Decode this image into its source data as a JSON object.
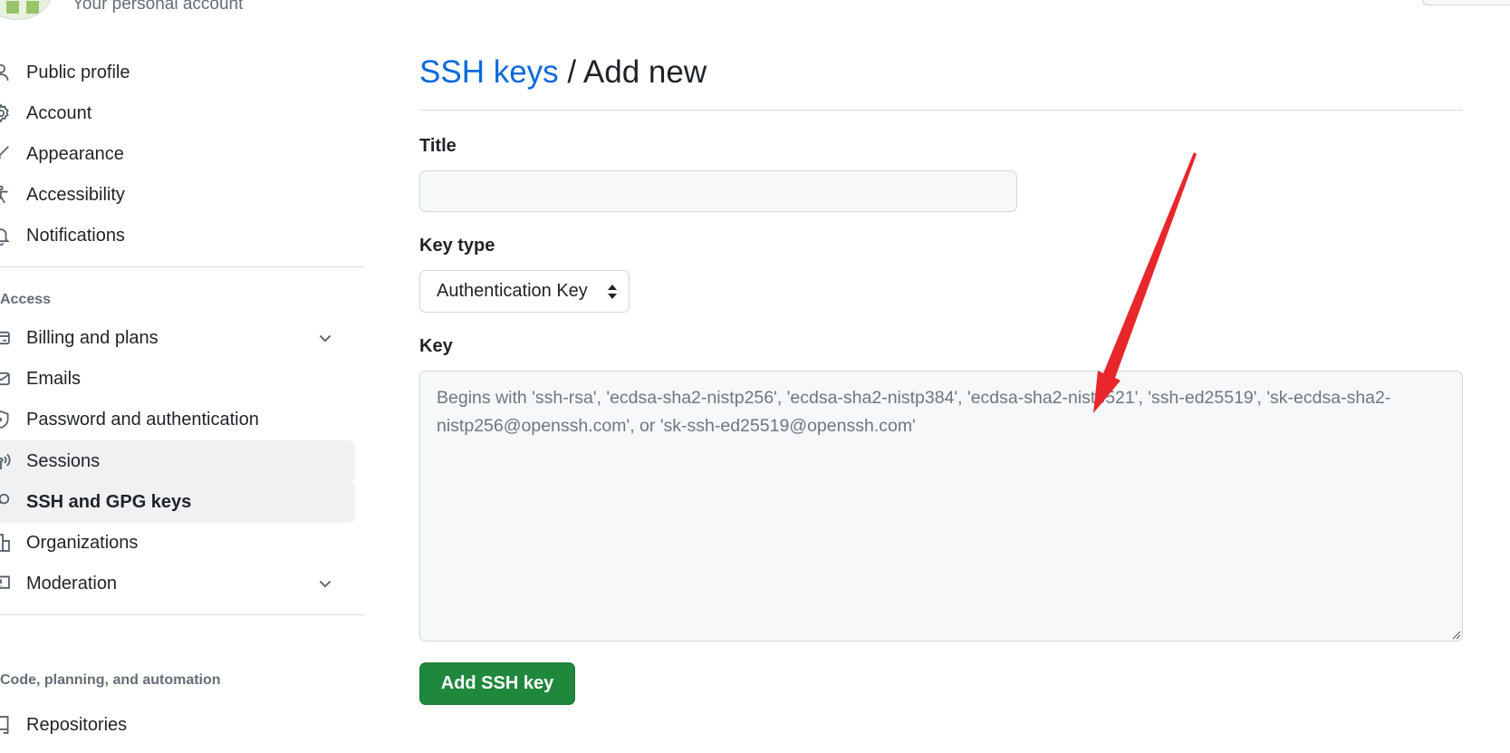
{
  "account": {
    "subtitle": "Your personal account"
  },
  "sidebar": {
    "items_top": [
      {
        "label": "Public profile",
        "icon": "person-icon"
      },
      {
        "label": "Account",
        "icon": "gear-icon"
      },
      {
        "label": "Appearance",
        "icon": "paintbrush-icon"
      },
      {
        "label": "Accessibility",
        "icon": "accessibility-icon"
      },
      {
        "label": "Notifications",
        "icon": "bell-icon"
      }
    ],
    "access_heading": "Access",
    "items_access": [
      {
        "label": "Billing and plans",
        "icon": "credit-card-icon",
        "expandable": true
      },
      {
        "label": "Emails",
        "icon": "mail-icon"
      },
      {
        "label": "Password and authentication",
        "icon": "shield-lock-icon"
      },
      {
        "label": "Sessions",
        "icon": "broadcast-icon",
        "state": "hover"
      },
      {
        "label": "SSH and GPG keys",
        "icon": "key-icon",
        "state": "active"
      },
      {
        "label": "Organizations",
        "icon": "organization-icon"
      },
      {
        "label": "Moderation",
        "icon": "report-icon",
        "expandable": true
      }
    ],
    "code_heading": "Code, planning, and automation",
    "items_code": [
      {
        "label": "Repositories",
        "icon": "repo-icon"
      }
    ]
  },
  "main": {
    "breadcrumb_link": "SSH keys",
    "breadcrumb_sep": " / ",
    "breadcrumb_current": "Add new",
    "title_label": "Title",
    "title_value": "",
    "key_type_label": "Key type",
    "key_type_value": "Authentication Key",
    "key_label": "Key",
    "key_placeholder": "Begins with 'ssh-rsa', 'ecdsa-sha2-nistp256', 'ecdsa-sha2-nistp384', 'ecdsa-sha2-nistp521', 'ssh-ed25519', 'sk-ecdsa-sha2-nistp256@openssh.com', or 'sk-ssh-ed25519@openssh.com'",
    "submit_label": "Add SSH key"
  },
  "colors": {
    "link": "#0969da",
    "primary_button": "#1f883d",
    "annotation_arrow": "#e8262b",
    "active_item_bg": "#eff1f3"
  }
}
